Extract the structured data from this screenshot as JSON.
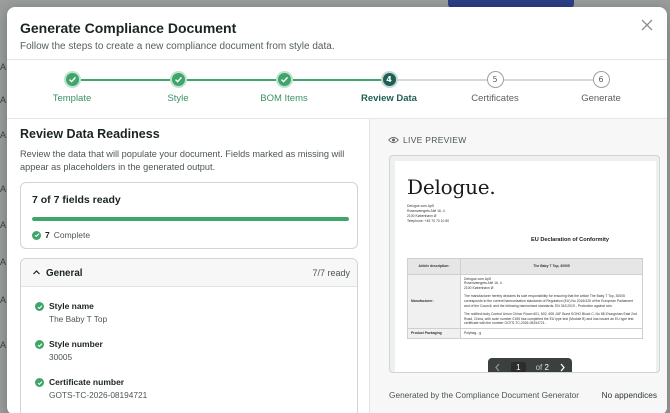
{
  "modal": {
    "title": "Generate Compliance Document",
    "subtitle": "Follow the steps to create a new compliance document from style data."
  },
  "background": {
    "letters": [
      "A",
      "A",
      "A",
      "A",
      "A",
      "A",
      "A",
      "A"
    ]
  },
  "colors": {
    "accent": "#1e5f56",
    "done": "#3fa56b"
  },
  "steps": [
    {
      "number": "1",
      "label": "Template",
      "state": "done"
    },
    {
      "number": "2",
      "label": "Style",
      "state": "done"
    },
    {
      "number": "3",
      "label": "BOM Items",
      "state": "done"
    },
    {
      "number": "4",
      "label": "Review Data",
      "state": "active"
    },
    {
      "number": "5",
      "label": "Certificates",
      "state": "todo"
    },
    {
      "number": "6",
      "label": "Generate",
      "state": "todo"
    }
  ],
  "review": {
    "title": "Review Data Readiness",
    "description": "Review the data that will populate your document. Fields marked as missing will appear as placeholders in the generated output.",
    "ready_title": "7 of 7 fields ready",
    "progress": 1.0,
    "complete_count": "7",
    "complete_label": "Complete"
  },
  "general": {
    "title": "General",
    "count": "7/7 ready",
    "fields": [
      {
        "name": "Style name",
        "value": "The Baby T Top"
      },
      {
        "name": "Style number",
        "value": "30005"
      },
      {
        "name": "Certificate number",
        "value": "GOTS-TC-2026-08194721"
      }
    ]
  },
  "preview": {
    "label": "LIVE PREVIEW",
    "doc": {
      "logo": "Delogue.",
      "address": [
        "Delogue.com ApS",
        "Rosenvængets Allé 16, 4.",
        "2100 København Ø",
        "Telephone: +45 70 70 10 80"
      ],
      "heading": "EU Declaration of Conformity",
      "table": {
        "article_label": "Article description:",
        "article_value": "The Baby T Top, 30005",
        "manufacturer_label": "Manufacturer:",
        "manufacturer_value_1": "Delogue.com ApS",
        "manufacturer_value_2": "Rosenvængets Allé 16, 4.",
        "manufacturer_value_3": "2100 København Ø",
        "manufacturer_text": "The manufacturer hereby declares its sole responsibility for ensuring that the article The Baby T Top, 30005 corresponds to the current harmonisation standards of Regulation (EU) No 2016/425 of the European Parliament and of the Council, and the following harmonised standards: EN 343:2019 - Protection against rain.",
        "notified_text": "The notified body Control Union China: Room 601, 602, 605 JUF Bund SOHO Block C, No 88 Zhongshan East 2nd Road, China, with code number 0155 has completed the EU type test (Module B) and has issued an EU type test certificate with the number GOTS-TC-2026-08194721.",
        "packaging_label": "Product Packaging",
        "packaging_value": "Polybag - g"
      }
    },
    "pager": {
      "current": "1",
      "of_text": "of",
      "total": "2"
    },
    "generated_by": "Generated by the Compliance Document Generator",
    "appendices": "No appendices"
  }
}
